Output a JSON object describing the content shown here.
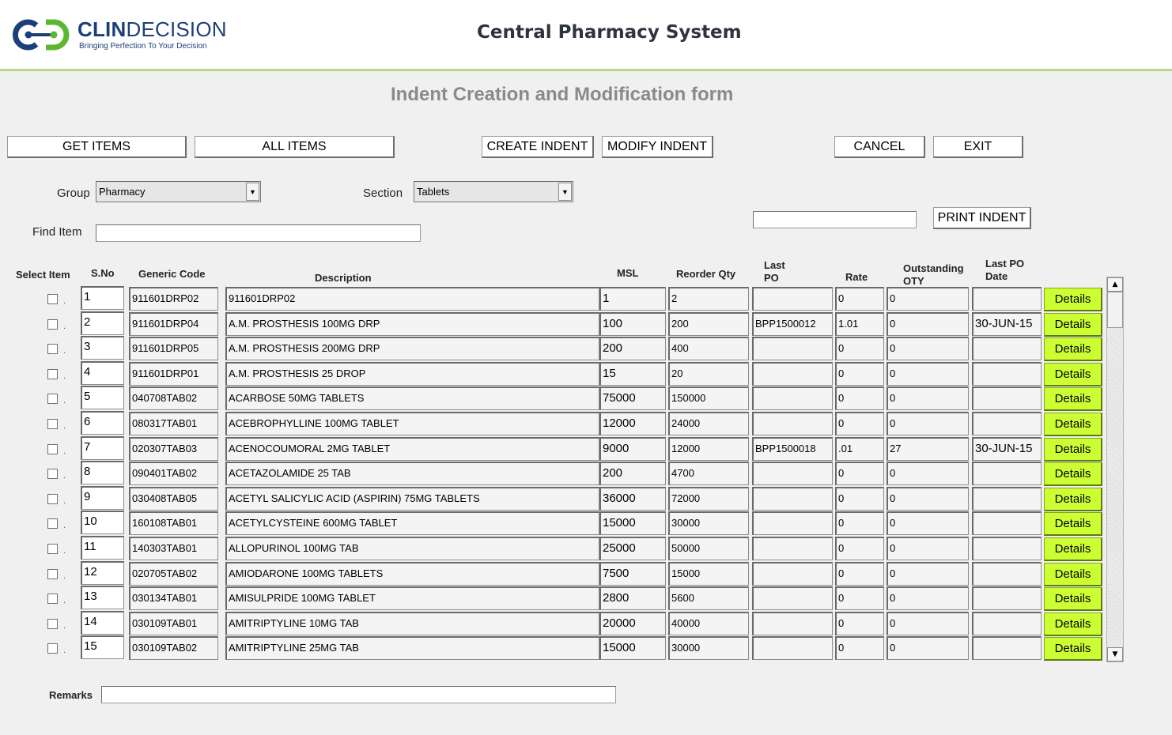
{
  "header": {
    "logo_name_bold": "CLIN",
    "logo_name_light": "DECISION",
    "logo_tagline": "Bringing Perfection To Your Decision",
    "app_title": "Central Pharmacy System"
  },
  "form": {
    "title": "Indent Creation and Modification form",
    "buttons": {
      "get_items": "GET ITEMS",
      "all_items": "ALL ITEMS",
      "create_indent": "CREATE  INDENT",
      "modify_indent": "MODIFY INDENT",
      "cancel": "CANCEL",
      "exit": "EXIT",
      "print_indent": "PRINT INDENT"
    },
    "group_label": "Group",
    "group_value": "Pharmacy",
    "section_label": "Section",
    "section_value": "Tablets",
    "find_label": "Find Item",
    "find_value": "",
    "print_value": "",
    "remarks_label": "Remarks",
    "remarks_value": ""
  },
  "table": {
    "headers": {
      "select": "Select Item",
      "sno": "S.No",
      "generic_code": "Generic Code",
      "description": "Description",
      "msl": "MSL",
      "reorder_qty": "Reorder Qty",
      "last_po_1": "Last",
      "last_po_2": "PO",
      "rate": "Rate",
      "outstanding_1": "Outstanding",
      "outstanding_2": "QTY",
      "last_po_date_1": "Last PO",
      "last_po_date_2": "Date"
    },
    "details_label": "Details",
    "rows": [
      {
        "sno": "1",
        "code": "911601DRP02",
        "desc": "911601DRP02",
        "msl": "1",
        "reorder": "2",
        "last_po": "",
        "rate": "0",
        "outstanding": "0",
        "po_date": ""
      },
      {
        "sno": "2",
        "code": "911601DRP04",
        "desc": "A.M. PROSTHESIS 100MG DRP",
        "msl": "100",
        "reorder": "200",
        "last_po": "BPP1500012",
        "rate": "1.01",
        "outstanding": "0",
        "po_date": "30-JUN-15"
      },
      {
        "sno": "3",
        "code": "911601DRP05",
        "desc": "A.M. PROSTHESIS 200MG DRP",
        "msl": "200",
        "reorder": "400",
        "last_po": "",
        "rate": "0",
        "outstanding": "0",
        "po_date": ""
      },
      {
        "sno": "4",
        "code": "911601DRP01",
        "desc": "A.M. PROSTHESIS 25 DROP",
        "msl": "15",
        "reorder": "20",
        "last_po": "",
        "rate": "0",
        "outstanding": "0",
        "po_date": ""
      },
      {
        "sno": "5",
        "code": "040708TAB02",
        "desc": "ACARBOSE  50MG  TABLETS",
        "msl": "75000",
        "reorder": "150000",
        "last_po": "",
        "rate": "0",
        "outstanding": "0",
        "po_date": ""
      },
      {
        "sno": "6",
        "code": "080317TAB01",
        "desc": "ACEBROPHYLLINE 100MG TABLET",
        "msl": "12000",
        "reorder": "24000",
        "last_po": "",
        "rate": "0",
        "outstanding": "0",
        "po_date": ""
      },
      {
        "sno": "7",
        "code": "020307TAB03",
        "desc": "ACENOCOUMORAL 2MG TABLET",
        "msl": "9000",
        "reorder": "12000",
        "last_po": "BPP1500018",
        "rate": ".01",
        "outstanding": "27",
        "po_date": "30-JUN-15"
      },
      {
        "sno": "8",
        "code": "090401TAB02",
        "desc": "ACETAZOLAMIDE 25 TAB",
        "msl": "200",
        "reorder": "4700",
        "last_po": "",
        "rate": "0",
        "outstanding": "0",
        "po_date": ""
      },
      {
        "sno": "9",
        "code": "030408TAB05",
        "desc": "ACETYL SALICYLIC ACID (ASPIRIN)  75MG  TABLETS",
        "msl": "36000",
        "reorder": "72000",
        "last_po": "",
        "rate": "0",
        "outstanding": "0",
        "po_date": ""
      },
      {
        "sno": "10",
        "code": "160108TAB01",
        "desc": "ACETYLCYSTEINE  600MG  TABLET",
        "msl": "15000",
        "reorder": "30000",
        "last_po": "",
        "rate": "0",
        "outstanding": "0",
        "po_date": ""
      },
      {
        "sno": "11",
        "code": "140303TAB01",
        "desc": "ALLOPURINOL  100MG  TAB",
        "msl": "25000",
        "reorder": "50000",
        "last_po": "",
        "rate": "0",
        "outstanding": "0",
        "po_date": ""
      },
      {
        "sno": "12",
        "code": "020705TAB02",
        "desc": "AMIODARONE  100MG  TABLETS",
        "msl": "7500",
        "reorder": "15000",
        "last_po": "",
        "rate": "0",
        "outstanding": "0",
        "po_date": ""
      },
      {
        "sno": "13",
        "code": "030134TAB01",
        "desc": "AMISULPRIDE 100MG TABLET",
        "msl": "2800",
        "reorder": "5600",
        "last_po": "",
        "rate": "0",
        "outstanding": "0",
        "po_date": ""
      },
      {
        "sno": "14",
        "code": "030109TAB01",
        "desc": "AMITRIPTYLINE  10MG  TAB",
        "msl": "20000",
        "reorder": "40000",
        "last_po": "",
        "rate": "0",
        "outstanding": "0",
        "po_date": ""
      },
      {
        "sno": "15",
        "code": "030109TAB02",
        "desc": "AMITRIPTYLINE  25MG  TAB",
        "msl": "15000",
        "reorder": "30000",
        "last_po": "",
        "rate": "0",
        "outstanding": "0",
        "po_date": ""
      }
    ]
  },
  "colors": {
    "details_button": "#ccff33",
    "panel_background": "#f0f0f0",
    "header_rule": "#b9d98f",
    "logo_blue": "#1c3f7a",
    "logo_green": "#5cb82e"
  },
  "icons": {
    "logo": "clindecision-logo-icon",
    "dropdown": "chevron-down-icon",
    "scroll_up": "arrow-up-icon",
    "scroll_down": "arrow-down-icon"
  }
}
